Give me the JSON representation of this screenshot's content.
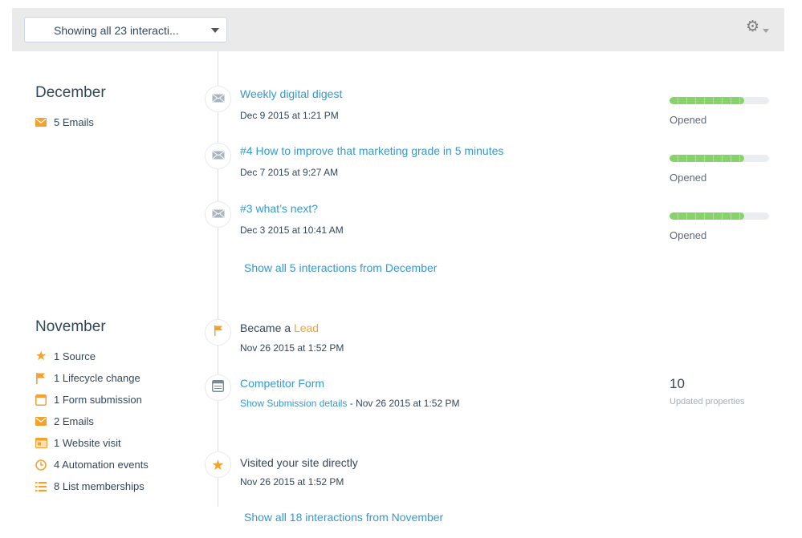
{
  "toolbar": {
    "filter_label": "Showing all 23 interacti...",
    "settings_icon": "gear-icon"
  },
  "months": [
    {
      "name": "December",
      "summary": [
        {
          "icon": "email-icon",
          "text": "5 Emails"
        }
      ],
      "show_all": "Show all 5 interactions from December"
    },
    {
      "name": "November",
      "summary": [
        {
          "icon": "star-icon",
          "text": "1 Source"
        },
        {
          "icon": "flag-icon",
          "text": "1 Lifecycle change"
        },
        {
          "icon": "form-icon",
          "text": "1 Form submission"
        },
        {
          "icon": "email-icon",
          "text": "2 Emails"
        },
        {
          "icon": "website-icon",
          "text": "1 Website visit"
        },
        {
          "icon": "clock-icon",
          "text": "4 Automation events"
        },
        {
          "icon": "list-icon",
          "text": "8 List memberships"
        }
      ],
      "show_all": "Show all 18 interactions from November"
    }
  ],
  "events": {
    "e1": {
      "title": "Weekly digital digest",
      "date": "Dec 9 2015 at 1:21 PM",
      "status": "Opened",
      "opened_fraction": 0.75
    },
    "e2": {
      "title": "#4 How to improve that marketing grade in 5 minutes",
      "date": "Dec 7 2015 at 9:27 AM",
      "status": "Opened",
      "opened_fraction": 0.75
    },
    "e3": {
      "title": "#3 what’s next?",
      "date": "Dec 3 2015 at 10:41 AM",
      "status": "Opened",
      "opened_fraction": 0.75
    },
    "lead": {
      "prefix": "Became a ",
      "stage": "Lead",
      "date": "Nov 26 2015 at 1:52 PM"
    },
    "form": {
      "title": "Competitor Form",
      "details_link": "Show Submission details",
      "date_suffix": " - Nov 26 2015 at 1:52 PM",
      "props_count": "10",
      "props_label": "Updated properties"
    },
    "visit": {
      "title": "Visited your site directly",
      "date": "Nov 26 2015 at 1:52 PM"
    }
  },
  "colors": {
    "accent_link": "#3598d1",
    "accent_orange": "#f5a12d",
    "opened_green": "#85d36a"
  }
}
